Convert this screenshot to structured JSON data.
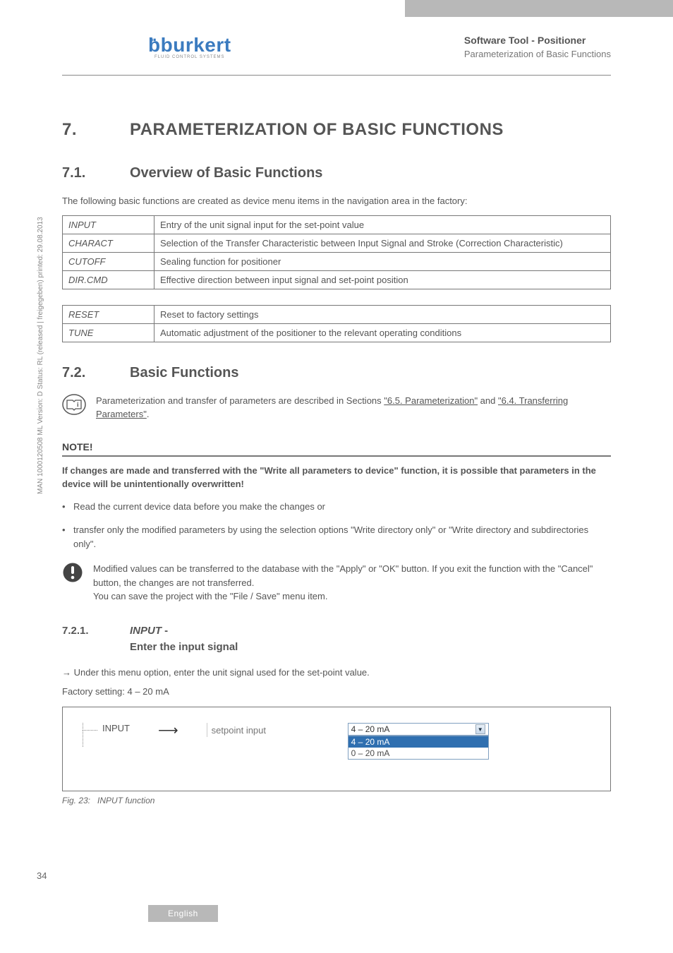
{
  "header": {
    "logo_text": "burkert",
    "logo_sub": "FLUID CONTROL SYSTEMS",
    "title1": "Software Tool - Positioner",
    "title2": "Parameterization of Basic Functions"
  },
  "section7": {
    "num": "7.",
    "title": "PARAMETERIZATION OF BASIC FUNCTIONS"
  },
  "section71": {
    "num": "7.1.",
    "title": "Overview of Basic Functions",
    "intro": "The following basic functions are created as device menu items in the navigation area in the factory:"
  },
  "table1": [
    {
      "name": "INPUT",
      "desc": "Entry of the unit signal input for the set-point value"
    },
    {
      "name": "CHARACT",
      "desc": "Selection of the Transfer Characteristic between Input Signal and Stroke (Correction Characteristic)"
    },
    {
      "name": "CUTOFF",
      "desc": "Sealing function for positioner"
    },
    {
      "name": "DIR.CMD",
      "desc": "Effective direction between input signal and set-point position"
    }
  ],
  "table2": [
    {
      "name": "RESET",
      "desc": "Reset to factory settings"
    },
    {
      "name": "TUNE",
      "desc": "Automatic adjustment of the positioner to the relevant operating conditions"
    }
  ],
  "section72": {
    "num": "7.2.",
    "title": "Basic Functions",
    "info_pre": "Parameterization and transfer of parameters are described in Sections ",
    "link1": "\"6.5. Parameterization\"",
    "mid": " and ",
    "link2": "\"6.4. Transferring Parameters\"",
    "end": "."
  },
  "note": {
    "heading": "NOTE!",
    "bold": "If changes are made and transferred with the \"Write all parameters to device\" function, it is possible that parameters in the device will be unintentionally overwritten!",
    "bullets": [
      "Read the current device data before you make the changes or",
      "transfer only the modified parameters by using the selection options \"Write directory only\" or \"Write directory and subdirectories only\"."
    ]
  },
  "warn": {
    "l1": "Modified values can be transferred to the database with the \"Apply\" or \"OK\" button. If you exit the function with the \"Cancel\" button, the changes are not transferred.",
    "l2": "You can save the project with the \"File / Save\" menu item."
  },
  "section721": {
    "num": "7.2.1.",
    "title_em": "INPUT",
    "title_dash": " -",
    "title_line2": "Enter the input signal",
    "arrow_text": "Under this menu option, enter the unit signal used for the set-point value.",
    "factory": "Factory setting: 4 – 20 mA"
  },
  "figure": {
    "tree_label": "INPUT",
    "field_label": "setpoint input",
    "selected": "4 – 20 mA",
    "options": [
      "4 – 20 mA",
      "0 – 20 mA"
    ],
    "caption_label": "Fig. 23:",
    "caption_text": "INPUT function"
  },
  "side_text": "MAN 1000120508 ML Version: D Status: RL (released | freigegeben) printed: 29.08.2013",
  "page_number": "34",
  "footer_lang": "English"
}
